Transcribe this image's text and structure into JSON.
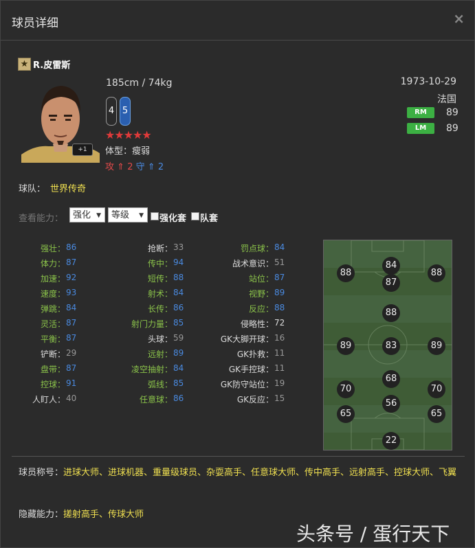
{
  "dialog": {
    "title": "球员详细",
    "close_label": "×"
  },
  "player": {
    "name": "R.皮雷斯",
    "rank_badge_icon": "star-icon",
    "boost_label": "+1",
    "height_weight": "185cm / 74kg",
    "left_foot": "4",
    "right_foot": "5",
    "stars": "★★★★★",
    "body_type": "体型：瘦弱",
    "attack_label": "攻",
    "attack_value": "2",
    "defense_label": "守",
    "defense_value": "2",
    "birthdate": "1973-10-29",
    "nationality": "法国",
    "positions": [
      {
        "pos": "RM",
        "rating": "89"
      },
      {
        "pos": "LM",
        "rating": "89"
      }
    ],
    "team_label": "球队：",
    "team": "世界传奇"
  },
  "controls": {
    "view_label": "查看能力：",
    "select1": "强化",
    "select2": "等级",
    "check1": "强化套",
    "check2": "队套"
  },
  "stats": {
    "col1": [
      {
        "label": "强壮",
        "value": "86",
        "lc": "#8bc34a",
        "vc": "#4a8ae0"
      },
      {
        "label": "体力",
        "value": "87",
        "lc": "#8bc34a",
        "vc": "#4a8ae0"
      },
      {
        "label": "加速",
        "value": "92",
        "lc": "#8bc34a",
        "vc": "#4a8ae0"
      },
      {
        "label": "速度",
        "value": "93",
        "lc": "#8bc34a",
        "vc": "#4a8ae0"
      },
      {
        "label": "弹跳",
        "value": "84",
        "lc": "#8bc34a",
        "vc": "#4a8ae0"
      },
      {
        "label": "灵活",
        "value": "87",
        "lc": "#8bc34a",
        "vc": "#4a8ae0"
      },
      {
        "label": "平衡",
        "value": "87",
        "lc": "#8bc34a",
        "vc": "#4a8ae0"
      },
      {
        "label": "铲断",
        "value": "29",
        "lc": "#dddddd",
        "vc": "#999999"
      },
      {
        "label": "盘带",
        "value": "87",
        "lc": "#8bc34a",
        "vc": "#4a8ae0"
      },
      {
        "label": "控球",
        "value": "91",
        "lc": "#8bc34a",
        "vc": "#4a8ae0"
      },
      {
        "label": "人盯人",
        "value": "40",
        "lc": "#dddddd",
        "vc": "#999999"
      }
    ],
    "col2": [
      {
        "label": "抢断",
        "value": "33",
        "lc": "#dddddd",
        "vc": "#999999"
      },
      {
        "label": "传中",
        "value": "94",
        "lc": "#8bc34a",
        "vc": "#4a8ae0"
      },
      {
        "label": "短传",
        "value": "88",
        "lc": "#8bc34a",
        "vc": "#4a8ae0"
      },
      {
        "label": "射术",
        "value": "84",
        "lc": "#8bc34a",
        "vc": "#4a8ae0"
      },
      {
        "label": "长传",
        "value": "86",
        "lc": "#8bc34a",
        "vc": "#4a8ae0"
      },
      {
        "label": "射门力量",
        "value": "85",
        "lc": "#8bc34a",
        "vc": "#4a8ae0"
      },
      {
        "label": "头球",
        "value": "59",
        "lc": "#dddddd",
        "vc": "#999999"
      },
      {
        "label": "远射",
        "value": "89",
        "lc": "#8bc34a",
        "vc": "#4a8ae0"
      },
      {
        "label": "凌空抽射",
        "value": "84",
        "lc": "#8bc34a",
        "vc": "#4a8ae0"
      },
      {
        "label": "弧线",
        "value": "85",
        "lc": "#8bc34a",
        "vc": "#4a8ae0"
      },
      {
        "label": "任意球",
        "value": "86",
        "lc": "#8bc34a",
        "vc": "#4a8ae0"
      }
    ],
    "col3": [
      {
        "label": "罚点球",
        "value": "84",
        "lc": "#8bc34a",
        "vc": "#4a8ae0"
      },
      {
        "label": "战术意识",
        "value": "51",
        "lc": "#dddddd",
        "vc": "#999999"
      },
      {
        "label": "站位",
        "value": "87",
        "lc": "#8bc34a",
        "vc": "#4a8ae0"
      },
      {
        "label": "视野",
        "value": "89",
        "lc": "#8bc34a",
        "vc": "#4a8ae0"
      },
      {
        "label": "反应",
        "value": "88",
        "lc": "#8bc34a",
        "vc": "#4a8ae0"
      },
      {
        "label": "侵略性",
        "value": "72",
        "lc": "#dddddd",
        "vc": "#dddddd"
      },
      {
        "label": "GK大脚开球",
        "value": "16",
        "lc": "#dddddd",
        "vc": "#999999"
      },
      {
        "label": "GK扑救",
        "value": "11",
        "lc": "#dddddd",
        "vc": "#999999"
      },
      {
        "label": "GK手控球",
        "value": "11",
        "lc": "#dddddd",
        "vc": "#999999"
      },
      {
        "label": "GK防守站位",
        "value": "19",
        "lc": "#dddddd",
        "vc": "#999999"
      },
      {
        "label": "GK反应",
        "value": "15",
        "lc": "#dddddd",
        "vc": "#999999"
      }
    ]
  },
  "pitch_ratings": [
    "88",
    "84",
    "88",
    "87",
    "88",
    "89",
    "83",
    "89",
    "68",
    "70",
    "70",
    "56",
    "65",
    "65",
    "22"
  ],
  "titles": {
    "label": "球员称号：",
    "value": "进球大师、进球机器、重量级球员、杂耍高手、任意球大师、传中高手、远射高手、控球大师、飞翼"
  },
  "hidden": {
    "label": "隐藏能力：",
    "value": "搓射高手、传球大师"
  },
  "watermark": "头条号 / 蛋行天下"
}
